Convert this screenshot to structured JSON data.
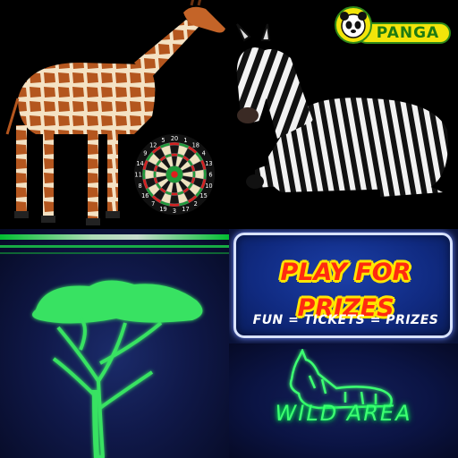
{
  "brand": {
    "logo_text": "PANGA"
  },
  "prizes": {
    "title": "PLAY FOR PRIZES",
    "subtitle": "FUN = TICKETS = PRIZES"
  },
  "wild_area": {
    "sign_text": "WILD AREA"
  },
  "dartboard": {
    "numbers": [
      "20",
      "1",
      "18",
      "4",
      "13",
      "6",
      "10",
      "15",
      "2",
      "17",
      "3",
      "19",
      "7",
      "16",
      "8",
      "11",
      "14",
      "9",
      "12",
      "5"
    ]
  },
  "colors": {
    "neon_green": "#3dff72",
    "prize_red": "#ff2a10",
    "prize_yellow": "#ffe600",
    "panel_blue": "#102a80",
    "logo_yellow": "#f2e50a",
    "logo_green": "#1e7a12"
  },
  "icons": [
    "giraffe-image",
    "zebra-image",
    "dartboard-icon",
    "panda-logo-icon",
    "acacia-tree-icon",
    "neon-zebra-icon"
  ]
}
